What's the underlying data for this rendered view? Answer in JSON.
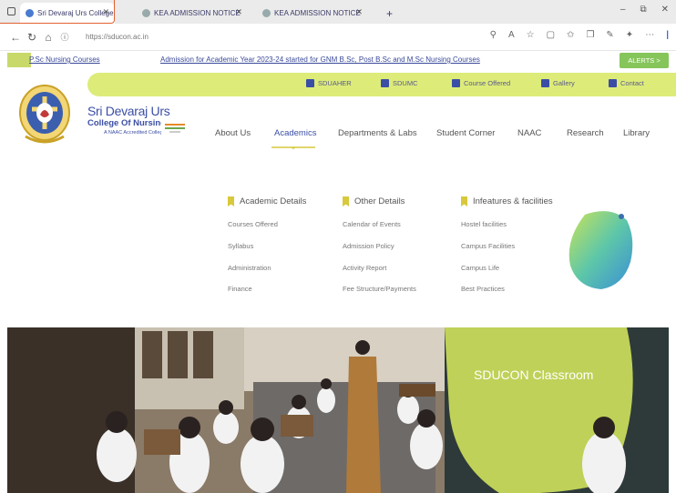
{
  "browser": {
    "tabs": [
      {
        "label": "Sri Devaraj Urs College o"
      },
      {
        "label": "KEA ADMISSION NOTICE"
      },
      {
        "label": "KEA ADMISSION NOTICE"
      }
    ],
    "new_tab": "+",
    "url": "https://sducon.ac.in"
  },
  "marquee": {
    "item1": "P.Sc Nursing Courses",
    "item2": "Admission for Academic Year 2023-24 started for GNM B.Sc, Post B.Sc and M.Sc Nursing Courses",
    "alerts_label": "ALERTS >"
  },
  "quick_links": [
    {
      "label": "SDUAHER"
    },
    {
      "label": "SDUMC"
    },
    {
      "label": "Course Offered"
    },
    {
      "label": "Gallery"
    },
    {
      "label": "Contact"
    }
  ],
  "brand": {
    "line1": "Sri Devaraj Urs",
    "line2": "College Of Nursing",
    "line3": "A NAAC Accredited College"
  },
  "nav": [
    {
      "label": "About Us"
    },
    {
      "label": "Academics"
    },
    {
      "label": "Departments & Labs"
    },
    {
      "label": "Student Corner"
    },
    {
      "label": "NAAC"
    },
    {
      "label": "Research"
    },
    {
      "label": "Library"
    }
  ],
  "menu": {
    "col1": {
      "title": "Academic Details",
      "links": [
        "Courses Offered",
        "Syllabus",
        "Administration",
        "Finance"
      ]
    },
    "col2": {
      "title": "Other Details",
      "links": [
        "Calendar of Events",
        "Admission Policy",
        "Activity Report",
        "Fee Structure/Payments"
      ]
    },
    "col3": {
      "title": "Infeatures & facilities",
      "links": [
        "Hostel facilities",
        "Campus Facilities",
        "Campus Life",
        "Best Practices"
      ]
    }
  },
  "hero": {
    "caption": "SDUCON Classroom"
  },
  "colors": {
    "accent": "#3b4ea5",
    "quickbar": "#ddeb79",
    "alerts": "#86c55a",
    "highlight_outline": "#e0612f"
  }
}
